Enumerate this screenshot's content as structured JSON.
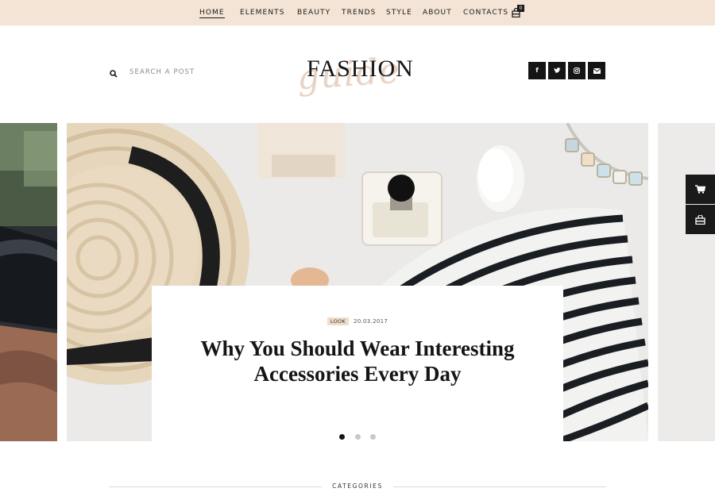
{
  "nav": {
    "items": [
      {
        "label": "HOME",
        "active": true
      },
      {
        "label": "ELEMENTS",
        "active": false
      },
      {
        "label": "BEAUTY",
        "active": false
      },
      {
        "label": "TRENDS",
        "active": false
      },
      {
        "label": "STYLE",
        "active": false
      },
      {
        "label": "ABOUT",
        "active": false
      },
      {
        "label": "CONTACTS",
        "active": false
      }
    ],
    "cart_icon": "shopping-bag-icon",
    "cart_count": "0"
  },
  "header": {
    "search": {
      "placeholder": "SEARCH A POST",
      "value": "",
      "icon": "search-icon"
    },
    "logo": {
      "main": "FASHION",
      "script": "guide"
    },
    "social": [
      {
        "icon": "facebook-icon",
        "glyph": "f"
      },
      {
        "icon": "twitter-icon",
        "glyph": "t"
      },
      {
        "icon": "instagram-icon",
        "glyph": "◎"
      },
      {
        "icon": "email-icon",
        "glyph": "✉"
      }
    ]
  },
  "slider": {
    "post": {
      "tag": "LOOK",
      "date": "20.03.2017",
      "title": "Why You Should Wear Interesting Accessories Every Day"
    },
    "dots": 3,
    "active_dot": 1
  },
  "side_buttons": [
    {
      "icon": "cart-icon"
    },
    {
      "icon": "store-icon"
    }
  ],
  "categories": {
    "title": "CATEGORIES"
  },
  "colors": {
    "topbar": "#f3e4d5",
    "dark": "#151515",
    "tag_bg": "#f0dccb",
    "logo_script": "#e8d3c4"
  }
}
